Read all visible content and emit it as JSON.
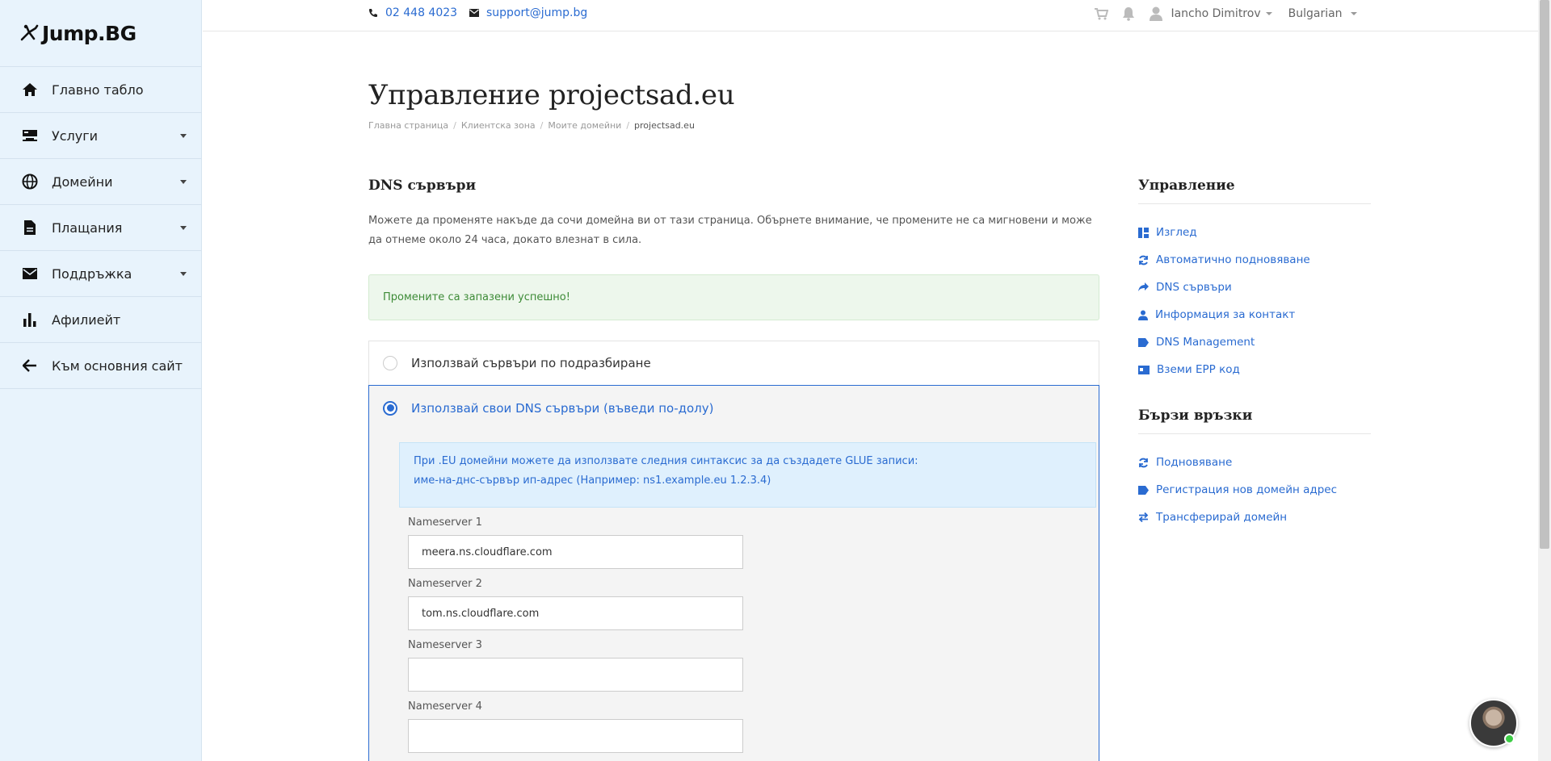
{
  "brand": {
    "name": "Jump.BG"
  },
  "sidebar": {
    "items": [
      {
        "label": "Главно табло",
        "icon": "home-icon",
        "has_caret": false
      },
      {
        "label": "Услуги",
        "icon": "server-icon",
        "has_caret": true
      },
      {
        "label": "Домейни",
        "icon": "globe-icon",
        "has_caret": true
      },
      {
        "label": "Плащания",
        "icon": "document-icon",
        "has_caret": true
      },
      {
        "label": "Поддръжка",
        "icon": "envelope-icon",
        "has_caret": true
      },
      {
        "label": "Афилиейт",
        "icon": "bar-chart-icon",
        "has_caret": false
      },
      {
        "label": "Към основния сайт",
        "icon": "arrow-left-icon",
        "has_caret": false
      }
    ]
  },
  "topbar": {
    "phone": "02 448 4023",
    "email": "support@jump.bg",
    "user_name": "Iancho Dimitrov",
    "language": "Bulgarian"
  },
  "main": {
    "title": "Управление projectsad.eu",
    "breadcrumb": [
      "Главна страница",
      "Клиентска зона",
      "Моите домейни",
      "projectsad.eu"
    ],
    "section_title": "DNS сървъри",
    "description": "Можете да променяте накъде да сочи домейна ви от тази страница. Обърнете внимание, че промените не са мигновени и може да отнеме около 24 часа, докато влезнат в сила.",
    "success_message": "Промените са запазени успешно!",
    "option_default": "Използвай сървъри по подразбиране",
    "option_custom": "Използвай свои DNS сървъри (въведи по-долу)",
    "info_line1": "При .EU домейни можете да използвате следния синтаксис за да създадете GLUE записи:",
    "info_line2": "име-на-днс-сървър ип-адрес (Например: ns1.example.eu 1.2.3.4)",
    "nameservers": [
      {
        "label": "Nameserver 1",
        "value": "meera.ns.cloudflare.com"
      },
      {
        "label": "Nameserver 2",
        "value": "tom.ns.cloudflare.com"
      },
      {
        "label": "Nameserver 3",
        "value": ""
      },
      {
        "label": "Nameserver 4",
        "value": ""
      }
    ]
  },
  "right": {
    "manage_title": "Управление",
    "manage_links": [
      {
        "label": "Изглед",
        "icon": "dashboard-icon"
      },
      {
        "label": "Автоматично подновяване",
        "icon": "refresh-icon"
      },
      {
        "label": "DNS сървъри",
        "icon": "share-arrow-icon"
      },
      {
        "label": "Информация за контакт",
        "icon": "user-icon"
      },
      {
        "label": "DNS Management",
        "icon": "tag-icon"
      },
      {
        "label": "Вземи EPP код",
        "icon": "id-card-icon"
      }
    ],
    "quick_title": "Бързи връзки",
    "quick_links": [
      {
        "label": "Подновяване",
        "icon": "refresh-icon"
      },
      {
        "label": "Регистрация нов домейн адрес",
        "icon": "tag-icon"
      },
      {
        "label": "Трансферирай домейн",
        "icon": "transfer-icon"
      }
    ]
  },
  "colors": {
    "accent": "#2a6bd1",
    "sidebar_bg": "#e8f3fc",
    "success_bg": "#edf7ec",
    "success_text": "#3d8b37",
    "info_bg": "#dff0fd"
  }
}
